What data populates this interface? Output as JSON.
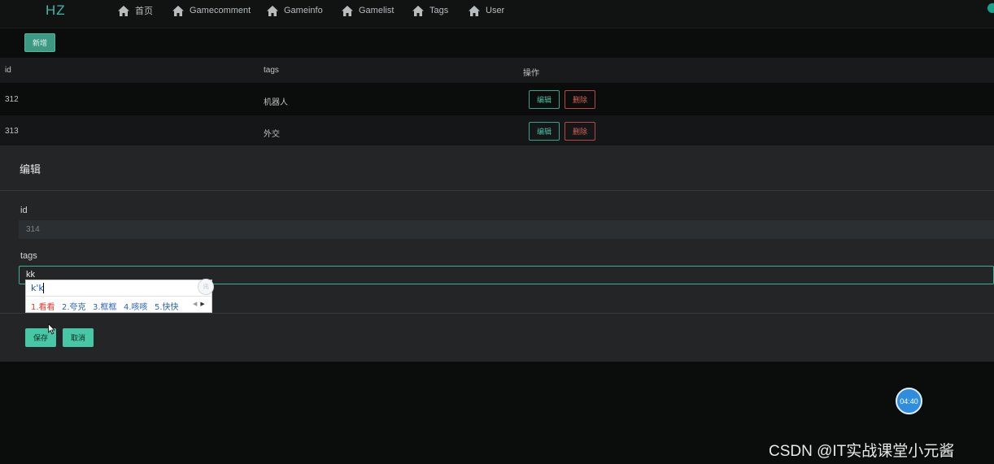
{
  "navbar": {
    "brand": "HZ",
    "items": [
      {
        "label": "首页",
        "icon": "home-icon"
      },
      {
        "label": "Gamecomment",
        "icon": "home-icon"
      },
      {
        "label": "Gameinfo",
        "icon": "home-icon"
      },
      {
        "label": "Gamelist",
        "icon": "home-icon"
      },
      {
        "label": "Tags",
        "icon": "home-icon"
      },
      {
        "label": "User",
        "icon": "home-icon"
      }
    ]
  },
  "toolbar": {
    "add_label": "新增"
  },
  "table": {
    "columns": [
      "id",
      "tags",
      "操作"
    ],
    "rows": [
      {
        "id": "312",
        "tags": "机器人",
        "edit": "编辑",
        "delete": "删除"
      },
      {
        "id": "313",
        "tags": "外交",
        "edit": "编辑",
        "delete": "删除"
      }
    ]
  },
  "modal": {
    "title": "编辑",
    "id_label": "id",
    "id_value": "314",
    "tags_label": "tags",
    "tags_value": "kk",
    "save_label": "保存",
    "cancel_label": "取消"
  },
  "ime": {
    "input": "k'k",
    "candidates": [
      "1.看看",
      "2.夸克",
      "3.框框",
      "4.咳咳",
      "5.快快"
    ],
    "logo": "讯",
    "prev": "◀",
    "next": "▶"
  },
  "timer": "04:40",
  "watermark": "CSDN @IT实战课堂小元酱",
  "colors": {
    "accent": "#48c7a6",
    "danger": "#d9615c",
    "background": "#0b0c0c",
    "modal": "#232527",
    "timer": "#2f8de0"
  }
}
